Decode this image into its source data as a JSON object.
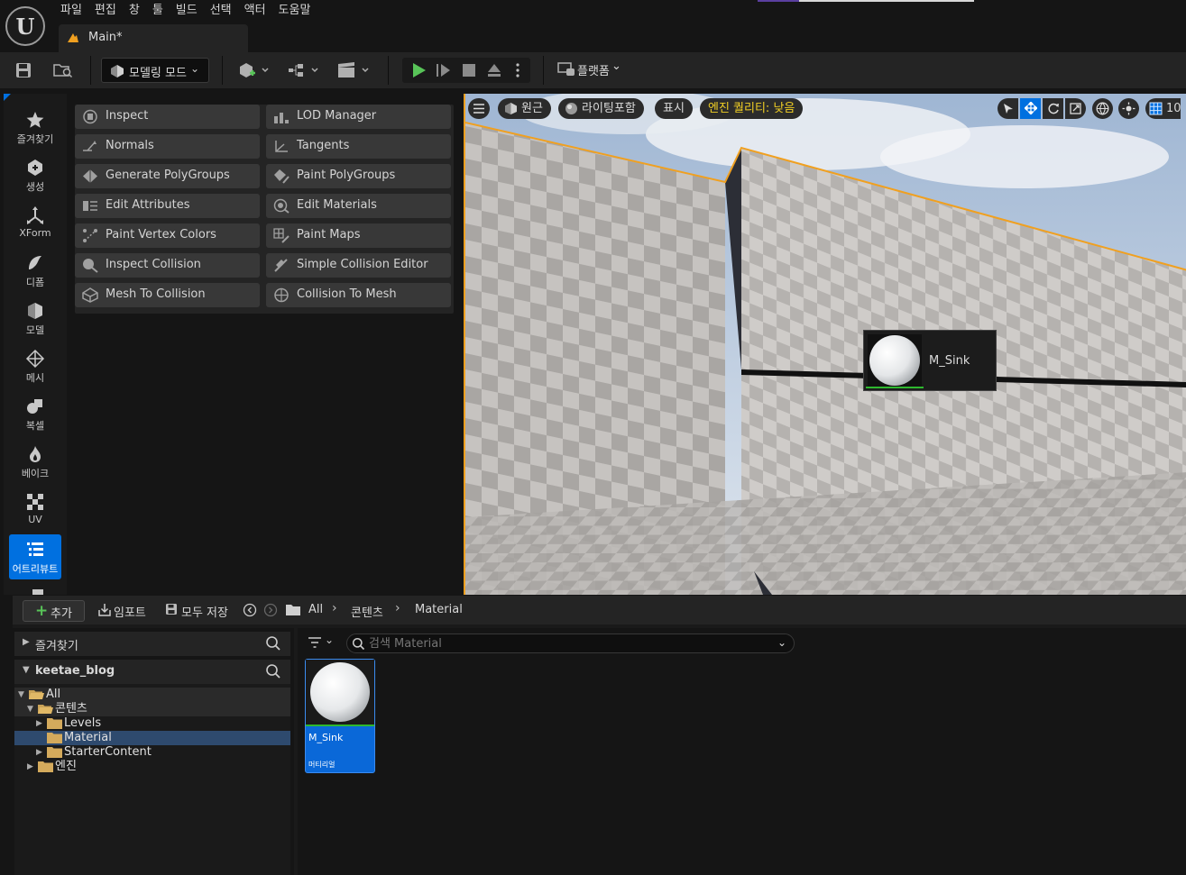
{
  "menu": [
    "파일",
    "편집",
    "창",
    "툴",
    "빌드",
    "선택",
    "액터",
    "도움말"
  ],
  "tab": {
    "title": "Main*"
  },
  "toolbar": {
    "mode_label": "모델링 모드",
    "platform_label": "플랫폼"
  },
  "modes": [
    {
      "label": "즐겨찾기",
      "icon": "star-icon"
    },
    {
      "label": "생성",
      "icon": "create-icon"
    },
    {
      "label": "XForm",
      "icon": "transform-icon"
    },
    {
      "label": "디폼",
      "icon": "deform-icon"
    },
    {
      "label": "모델",
      "icon": "model-icon"
    },
    {
      "label": "메시",
      "icon": "mesh-icon"
    },
    {
      "label": "복셀",
      "icon": "voxel-icon"
    },
    {
      "label": "베이크",
      "icon": "bake-icon"
    },
    {
      "label": "UV",
      "icon": "uv-icon"
    },
    {
      "label": "어트리뷰트",
      "icon": "attributes-icon",
      "active": true
    }
  ],
  "tools": [
    "Inspect",
    "LOD Manager",
    "Normals",
    "Tangents",
    "Generate PolyGroups",
    "Paint PolyGroups",
    "Edit Attributes",
    "Edit Materials",
    "Paint Vertex Colors",
    "Paint Maps",
    "Inspect Collision",
    "Simple Collision Editor",
    "Mesh To Collision",
    "Collision To Mesh"
  ],
  "viewport": {
    "perspective": "원근",
    "lighting": "라이팅포함",
    "show": "표시",
    "quality": "엔진 퀄리티: 낮음",
    "grid_value": "10",
    "material_label": "M_Sink"
  },
  "content_browser": {
    "add": "추가",
    "import": "임포트",
    "save_all": "모두 저장",
    "breadcrumb": [
      "All",
      "콘텐츠",
      "Material"
    ],
    "favorites": "즐겨찾기",
    "project": "keetae_blog",
    "tree": [
      {
        "label": "All",
        "depth": 0,
        "expanded": true
      },
      {
        "label": "콘텐츠",
        "depth": 1,
        "expanded": true
      },
      {
        "label": "Levels",
        "depth": 2,
        "expanded": false
      },
      {
        "label": "Material",
        "depth": 2,
        "selected": true
      },
      {
        "label": "StarterContent",
        "depth": 2,
        "expanded": false
      },
      {
        "label": "엔진",
        "depth": 1,
        "expanded": false
      }
    ],
    "search_placeholder": "검색 Material",
    "asset": {
      "name": "M_Sink",
      "type": "머티리얼"
    }
  },
  "colors": {
    "accent_blue": "#0070e0",
    "selection_orange": "#f0a020",
    "quality_yellow": "#f2d024",
    "play_green": "#58c458"
  }
}
